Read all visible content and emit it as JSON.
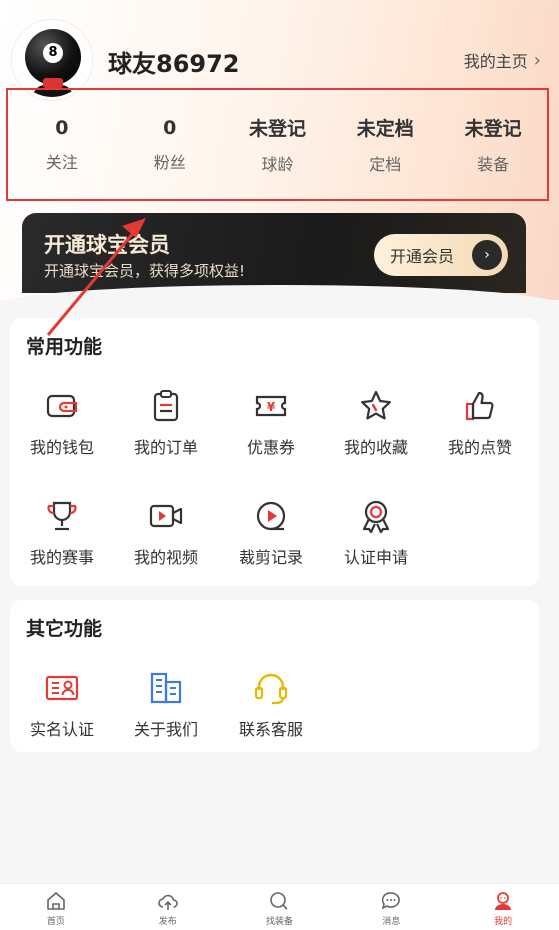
{
  "profile": {
    "avatar_number": "8",
    "username": "球友86972",
    "homepage_label": "我的主页"
  },
  "stats": [
    {
      "value": "0",
      "label": "关注"
    },
    {
      "value": "0",
      "label": "粉丝"
    },
    {
      "value": "未登记",
      "label": "球龄"
    },
    {
      "value": "未定档",
      "label": "定档"
    },
    {
      "value": "未登记",
      "label": "装备"
    }
  ],
  "vip": {
    "title": "开通球宝会员",
    "subtitle": "开通球宝会员，获得多项权益!",
    "button_label": "开通会员"
  },
  "common_functions": {
    "title": "常用功能",
    "items": [
      {
        "label": "我的钱包",
        "icon": "wallet-icon"
      },
      {
        "label": "我的订单",
        "icon": "order-icon"
      },
      {
        "label": "优惠券",
        "icon": "coupon-icon"
      },
      {
        "label": "我的收藏",
        "icon": "star-icon"
      },
      {
        "label": "我的点赞",
        "icon": "thumbs-up-icon"
      },
      {
        "label": "我的赛事",
        "icon": "trophy-icon"
      },
      {
        "label": "我的视频",
        "icon": "video-icon"
      },
      {
        "label": "裁剪记录",
        "icon": "play-circle-icon"
      },
      {
        "label": "认证申请",
        "icon": "certificate-icon"
      }
    ]
  },
  "other_functions": {
    "title": "其它功能",
    "items": [
      {
        "label": "实名认证",
        "icon": "id-card-icon"
      },
      {
        "label": "关于我们",
        "icon": "building-icon"
      },
      {
        "label": "联系客服",
        "icon": "headset-icon"
      }
    ]
  },
  "tabbar": [
    {
      "label": "首页",
      "icon": "home-icon",
      "active": false
    },
    {
      "label": "发布",
      "icon": "upload-cloud-icon",
      "active": false
    },
    {
      "label": "找装备",
      "icon": "search-icon",
      "active": false
    },
    {
      "label": "消息",
      "icon": "message-icon",
      "active": false
    },
    {
      "label": "我的",
      "icon": "profile-icon",
      "active": true
    }
  ],
  "colors": {
    "accent": "#e53935",
    "icon_red": "#e53935",
    "icon_blue": "#3b7be0",
    "icon_yellow": "#e6b800",
    "vip_bg": "#1f1f1f"
  }
}
